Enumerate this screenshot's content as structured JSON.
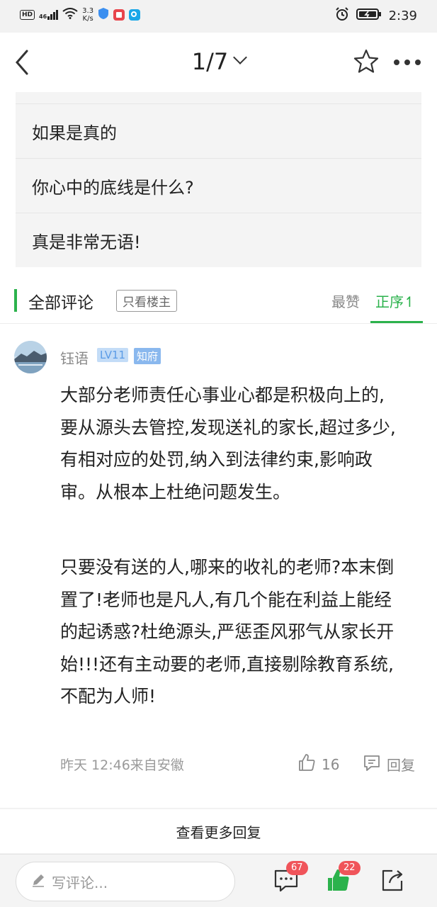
{
  "status_bar": {
    "hd": "HD",
    "signal": "46",
    "speed_value": "3.3",
    "speed_unit": "K/s",
    "time": "2:39"
  },
  "header": {
    "page_indicator": "1/7"
  },
  "quote": {
    "lines": [
      "如果是真的",
      "你心中的底线是什么?",
      "真是非常无语!"
    ]
  },
  "comments_header": {
    "title": "全部评论",
    "op_only": "只看楼主",
    "sort_hot": "最赞",
    "sort_asc": "正序↿"
  },
  "comment": {
    "username": "钰语",
    "level": "LV11",
    "rank": "知府",
    "paragraphs": [
      "大部分老师责任心事业心都是积极向上的,要从源头去管控,发现送礼的家长,超过多少,有相对应的处罚,纳入到法律约束,影响政审。从根本上杜绝问题发生。",
      "只要没有送的人,哪来的收礼的老师?本末倒置了!老师也是凡人,有几个能在利益上能经的起诱惑?杜绝源头,严惩歪风邪气从家长开始!!!还有主动要的老师,直接剔除教育系统,不配为人师!"
    ],
    "meta": "昨天 12:46来自安徽",
    "likes": "16",
    "reply_label": "回复"
  },
  "more_replies": "查看更多回复",
  "bottom_bar": {
    "placeholder": "写评论...",
    "comment_count": "67",
    "like_count": "22"
  },
  "colors": {
    "accent": "#2bb24c",
    "badge": "#f0545a",
    "level_bg": "#c3dcf7",
    "rank_bg": "#8ab8ee"
  }
}
